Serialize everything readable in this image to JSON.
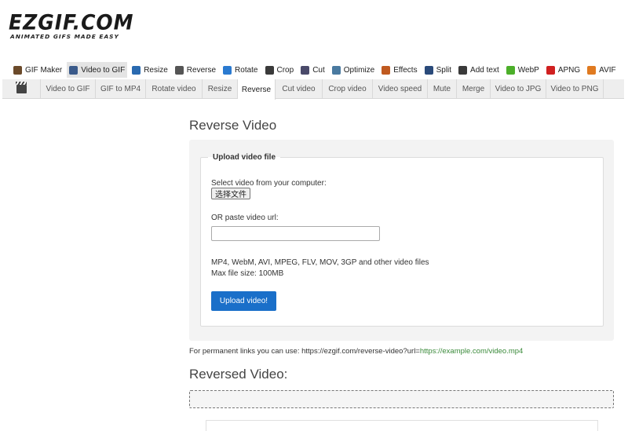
{
  "logo": {
    "main": "EZGIF.COM",
    "tagline": "ANIMATED GIFS MADE EASY"
  },
  "main_nav": [
    {
      "label": "GIF Maker",
      "icon": "gif-maker-icon",
      "color": "#6b4a2a",
      "active": false
    },
    {
      "label": "Video to GIF",
      "icon": "video-to-gif-icon",
      "color": "#3a5a8a",
      "active": true
    },
    {
      "label": "Resize",
      "icon": "resize-icon",
      "color": "#2a6ab0",
      "active": false
    },
    {
      "label": "Reverse",
      "icon": "reverse-icon",
      "color": "#555555",
      "active": false
    },
    {
      "label": "Rotate",
      "icon": "rotate-icon",
      "color": "#2a7ad0",
      "active": false
    },
    {
      "label": "Crop",
      "icon": "crop-icon",
      "color": "#3a3a3a",
      "active": false
    },
    {
      "label": "Cut",
      "icon": "cut-icon",
      "color": "#4a4a6a",
      "active": false
    },
    {
      "label": "Optimize",
      "icon": "optimize-icon",
      "color": "#4a7aa0",
      "active": false
    },
    {
      "label": "Effects",
      "icon": "effects-icon",
      "color": "#c05a20",
      "active": false
    },
    {
      "label": "Split",
      "icon": "split-icon",
      "color": "#2a4a7a",
      "active": false
    },
    {
      "label": "Add text",
      "icon": "add-text-icon",
      "color": "#3a3a3a",
      "active": false
    },
    {
      "label": "WebP",
      "icon": "webp-icon",
      "color": "#4caf2a",
      "active": false
    },
    {
      "label": "APNG",
      "icon": "apng-icon",
      "color": "#d02020",
      "active": false
    },
    {
      "label": "AVIF",
      "icon": "avif-icon",
      "color": "#e07a20",
      "active": false
    }
  ],
  "sub_nav": [
    {
      "label": "Video to GIF",
      "active": false
    },
    {
      "label": "GIF to MP4",
      "active": false
    },
    {
      "label": "Rotate video",
      "active": false
    },
    {
      "label": "Resize",
      "active": false
    },
    {
      "label": "Reverse",
      "active": true
    },
    {
      "label": "Cut video",
      "active": false
    },
    {
      "label": "Crop video",
      "active": false
    },
    {
      "label": "Video speed",
      "active": false
    },
    {
      "label": "Mute",
      "active": false
    },
    {
      "label": "Merge",
      "active": false
    },
    {
      "label": "Video to JPG",
      "active": false
    },
    {
      "label": "Video to PNG",
      "active": false
    }
  ],
  "page": {
    "title": "Reverse Video",
    "upload_legend": "Upload video file",
    "select_label": "Select video from your computer:",
    "file_button": "选择文件",
    "file_status": "",
    "url_label": "OR paste video url:",
    "url_value": "",
    "formats": "MP4, WebM, AVI, MPEG, FLV, MOV, 3GP and other video files",
    "max_size": "Max file size: 100MB",
    "upload_button": "Upload video!",
    "permalink_prefix": "For permanent links you can use: https://ezgif.com/reverse-video?url=",
    "permalink_example": "https://example.com/video.mp4",
    "result_title": "Reversed Video:"
  },
  "colors": {
    "accent": "#1a6fc9",
    "link_green": "#3a8a3a"
  }
}
